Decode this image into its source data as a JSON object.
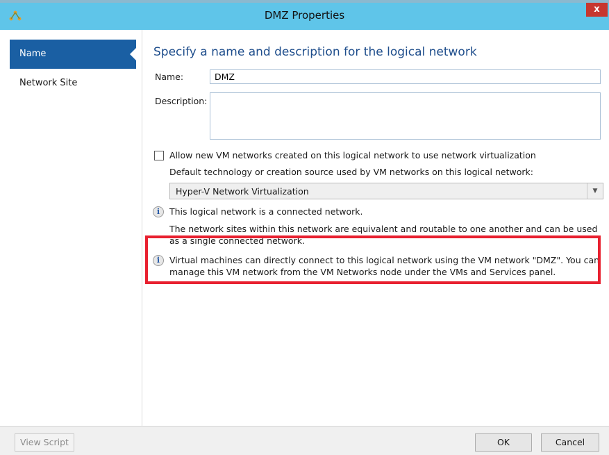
{
  "window": {
    "title": "DMZ Properties",
    "close_label": "x",
    "icon": "network-app-icon"
  },
  "sidebar": {
    "items": [
      {
        "label": "Name",
        "active": true
      },
      {
        "label": "Network Site",
        "active": false
      }
    ]
  },
  "main": {
    "heading": "Specify a name and description for the logical network",
    "name_label": "Name:",
    "name_value": "DMZ",
    "description_label": "Description:",
    "description_value": "",
    "virtualization_checkbox_label": "Allow new VM networks created on this logical network to use network virtualization",
    "virtualization_checked": false,
    "default_tech_label": "Default technology or creation source used by VM networks on this logical network:",
    "default_tech_value": "Hyper-V Network Virtualization",
    "info1": "This logical network is a connected network.",
    "info1_detail": "The network sites within this network are equivalent and routable to one another and can be used as a single connected network.",
    "info2": "Virtual machines can directly connect to this logical network using the VM network \"DMZ\". You can manage this VM network from the VM Networks node under the VMs and Services panel."
  },
  "footer": {
    "view_script_label": "View Script",
    "ok_label": "OK",
    "cancel_label": "Cancel"
  },
  "colors": {
    "titlebar": "#5fc5e9",
    "sidebar_active": "#1a5fa3",
    "heading": "#1f4e8c",
    "highlight": "#e8202f",
    "close_button": "#c7372f"
  }
}
